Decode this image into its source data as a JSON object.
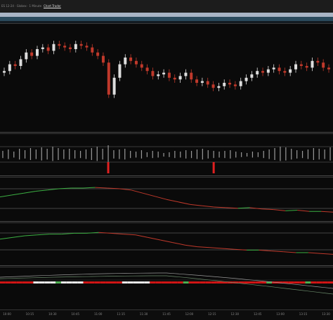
{
  "window": {
    "title_text": "ES 12-24 · Globex · 1 Minute",
    "menu_label": "Chart Trader"
  },
  "colors": {
    "background": "#0a0a0a",
    "candle_up": "#dddddd",
    "candle_down": "#c0392b",
    "osc_up": "#3cb043",
    "osc_down": "#c0392b",
    "histogram": "#9a9a9a",
    "histogram_alert": "#e02020",
    "strip_red": "#d01515",
    "strip_white": "#e8e8e8",
    "strip_green": "#4caf50"
  },
  "chart_data": {
    "type": "line",
    "panels": [
      "price-candles",
      "volume-delta-histogram",
      "oscillator-1",
      "oscillator-2",
      "signal-strip"
    ],
    "candle_closes": [
      22,
      26,
      25,
      29,
      33,
      31,
      35,
      36,
      34,
      38,
      37,
      36,
      35,
      38,
      37,
      36,
      33,
      31,
      27,
      8,
      18,
      26,
      30,
      28,
      26,
      24,
      22,
      19,
      20,
      21,
      18,
      17,
      19,
      21,
      17,
      15,
      16,
      14,
      12,
      13,
      15,
      14,
      13,
      16,
      18,
      20,
      22,
      21,
      23,
      24,
      22,
      21,
      23,
      26,
      25,
      24,
      28,
      27,
      24,
      23
    ],
    "oscillator_1": [
      16,
      19,
      22,
      25,
      27,
      29,
      30,
      30,
      31,
      30,
      29,
      27,
      22,
      17,
      12,
      8,
      4,
      2,
      0,
      -1,
      -2,
      -1,
      -3,
      -4,
      -6,
      -5,
      -7,
      -7,
      -8
    ],
    "oscillator_2": [
      6,
      8,
      10,
      11,
      12,
      12,
      13,
      13,
      14,
      13,
      12,
      11,
      8,
      5,
      2,
      -1,
      -3,
      -4,
      -5,
      -6,
      -7,
      -7,
      -8,
      -9,
      -10,
      -10,
      -11,
      -12
    ],
    "histogram": [
      6,
      8,
      5,
      9,
      7,
      10,
      8,
      11,
      9,
      12,
      10,
      8,
      9,
      7,
      6,
      8,
      10,
      12,
      9,
      14,
      7,
      8,
      9,
      6,
      5,
      7,
      4,
      6,
      5,
      3,
      4,
      6,
      5,
      7,
      6,
      8,
      9,
      7,
      6,
      5,
      6,
      7,
      5,
      4,
      3,
      5,
      4,
      6,
      8,
      10,
      12,
      11,
      9,
      7,
      6,
      8,
      10,
      9,
      8,
      11
    ],
    "histogram_alerts": [
      19,
      38
    ],
    "grid": false,
    "legend": "none"
  },
  "time_axis": {
    "ticks": [
      "10:00",
      "10:15",
      "10:30",
      "10:45",
      "11:00",
      "11:15",
      "11:30",
      "11:45",
      "12:00",
      "12:15",
      "12:30",
      "12:45",
      "13:00",
      "13:15",
      "13:30"
    ]
  }
}
